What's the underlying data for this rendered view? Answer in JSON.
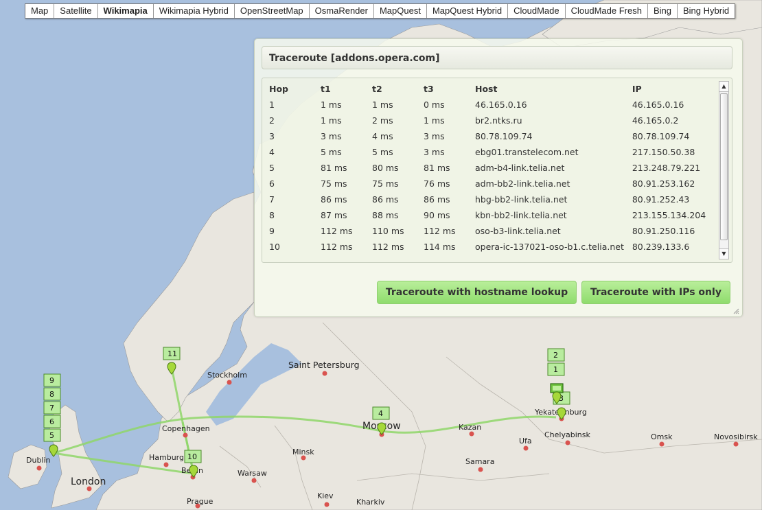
{
  "map_types": [
    {
      "label": "Map",
      "active": false
    },
    {
      "label": "Satellite",
      "active": false
    },
    {
      "label": "Wikimapia",
      "active": true
    },
    {
      "label": "Wikimapia Hybrid",
      "active": false
    },
    {
      "label": "OpenStreetMap",
      "active": false
    },
    {
      "label": "OsmaRender",
      "active": false
    },
    {
      "label": "MapQuest",
      "active": false
    },
    {
      "label": "MapQuest Hybrid",
      "active": false
    },
    {
      "label": "CloudMade",
      "active": false
    },
    {
      "label": "CloudMade Fresh",
      "active": false
    },
    {
      "label": "Bing",
      "active": false
    },
    {
      "label": "Bing Hybrid",
      "active": false
    }
  ],
  "panel": {
    "title": "Traceroute [addons.opera.com]",
    "columns": [
      "Hop",
      "t1",
      "t2",
      "t3",
      "Host",
      "IP"
    ],
    "rows": [
      [
        "1",
        "1 ms",
        "1 ms",
        "0 ms",
        "46.165.0.16",
        "46.165.0.16"
      ],
      [
        "2",
        "1 ms",
        "2 ms",
        "1 ms",
        "br2.ntks.ru",
        "46.165.0.2"
      ],
      [
        "3",
        "3 ms",
        "4 ms",
        "3 ms",
        "80.78.109.74",
        "80.78.109.74"
      ],
      [
        "4",
        "5 ms",
        "5 ms",
        "3 ms",
        "ebg01.transtelecom.net",
        "217.150.50.38"
      ],
      [
        "5",
        "81 ms",
        "80 ms",
        "81 ms",
        "adm-b4-link.telia.net",
        "213.248.79.221"
      ],
      [
        "6",
        "75 ms",
        "75 ms",
        "76 ms",
        "adm-bb2-link.telia.net",
        "80.91.253.162"
      ],
      [
        "7",
        "86 ms",
        "86 ms",
        "86 ms",
        "hbg-bb2-link.telia.net",
        "80.91.252.43"
      ],
      [
        "8",
        "87 ms",
        "88 ms",
        "90 ms",
        "kbn-bb2-link.telia.net",
        "213.155.134.204"
      ],
      [
        "9",
        "112 ms",
        "110 ms",
        "112 ms",
        "oso-b3-link.telia.net",
        "80.91.250.116"
      ],
      [
        "10",
        "112 ms",
        "112 ms",
        "114 ms",
        "opera-ic-137021-oso-b1.c.telia.net",
        "80.239.133.6"
      ]
    ],
    "btn_hostname": "Traceroute with hostname lookup",
    "btn_ips": "Traceroute with IPs only"
  },
  "map": {
    "cities": {
      "saint_petersburg": "Saint Petersburg",
      "stockholm": "Stockholm",
      "copenhagen": "Copenhagen",
      "hamburg": "Hamburg",
      "berlin": "Berlin",
      "dublin": "Dublin",
      "london": "London",
      "minsk": "Minsk",
      "warsaw": "Warsaw",
      "moscow": "Moscow",
      "kazan": "Kazan",
      "samara": "Samara",
      "ufa": "Ufa",
      "chelyabinsk": "Chelyabinsk",
      "yekaterinburg": "Yekaterinburg",
      "omsk": "Omsk",
      "novosibirsk": "Novosibirsk",
      "prague": "Prague",
      "kiev": "Kiev",
      "kharkiv": "Kharkiv"
    },
    "hop_labels": {
      "h11": "11",
      "h10": "10",
      "h9": "9",
      "h8": "8",
      "h7": "7",
      "h6": "6",
      "h5": "5",
      "h4": "4",
      "h2": "2",
      "h1": "1",
      "h3": "3"
    },
    "colors": {
      "water": "#a8c0de",
      "land": "#e9e6df",
      "route": "#8fd66a",
      "city_dot": "#d9534f"
    }
  }
}
